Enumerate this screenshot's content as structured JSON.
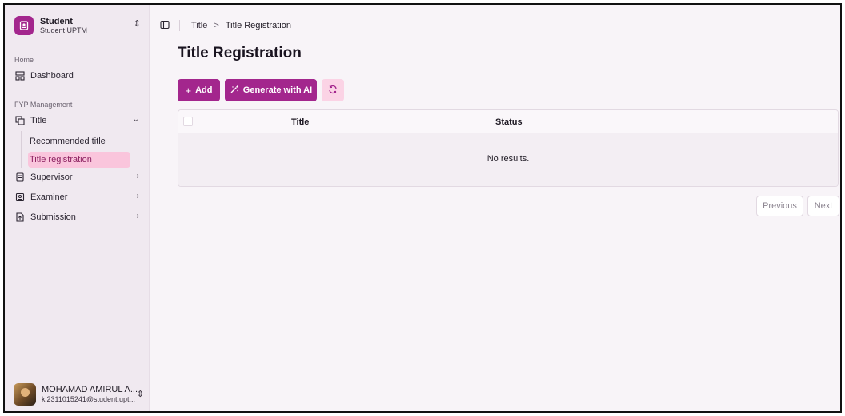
{
  "team": {
    "name": "Student",
    "subtitle": "Student UPTM"
  },
  "sidebar": {
    "group_home": "Home",
    "dashboard": "Dashboard",
    "group_fyp": "FYP Management",
    "title": "Title",
    "sub_items": [
      "Recommended title",
      "Title registration"
    ],
    "supervisor": "Supervisor",
    "examiner": "Examiner",
    "submission": "Submission"
  },
  "user": {
    "name": "MOHAMAD AMIRUL A...",
    "email": "kl2311015241@student.upt..."
  },
  "breadcrumb": {
    "parent": "Title",
    "separator": ">",
    "current": "Title Registration"
  },
  "page": {
    "title": "Title Registration"
  },
  "actions": {
    "add": "Add",
    "generate": "Generate with AI"
  },
  "table": {
    "columns": [
      "Title",
      "Status"
    ],
    "empty_text": "No results."
  },
  "pagination": {
    "previous": "Previous",
    "next": "Next"
  },
  "colors": {
    "accent": "#a3268d",
    "active_bg": "#fac5dc",
    "refresh_bg": "#fbd3e5"
  }
}
